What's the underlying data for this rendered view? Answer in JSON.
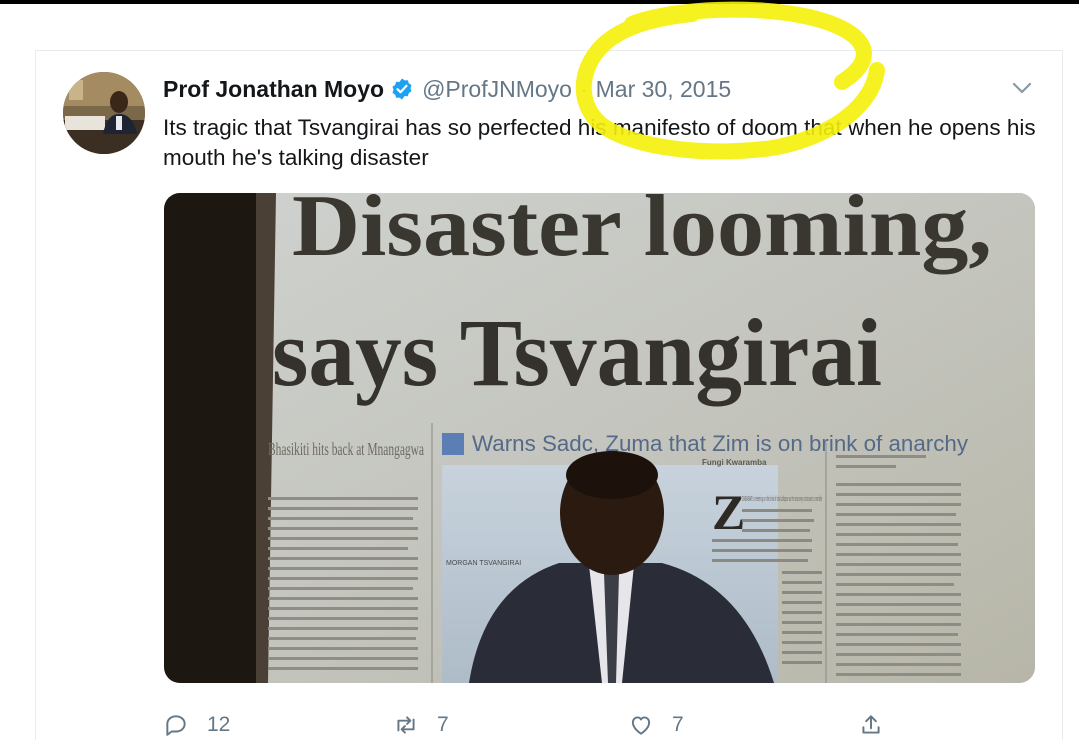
{
  "tweet": {
    "author_name": "Prof Jonathan Moyo",
    "handle": "@ProfJNMoyo",
    "separator": "·",
    "date": "Mar 30, 2015",
    "text": "Its tragic that Tsvangirai has so perfected his manifesto of doom that when he opens his mouth he's talking disaster",
    "verified": true,
    "icons": [
      "verified-badge-icon",
      "chevron-down-icon",
      "reply-icon",
      "retweet-icon",
      "like-icon",
      "share-icon"
    ]
  },
  "media": {
    "headline_line1": "Disaster looming,",
    "headline_line2": "says Tsvangirai",
    "subhead": "Warns Sadc, Zuma that Zim is on brink of anarchy",
    "side_headline": "Bhasikiti hits back at Mnangagwa",
    "photo_caption": "MORGAN TSVANGIRAI",
    "byline": "Fungi Kwaramba",
    "column_text": "ZIMBABWE is teetering on the brink of total collapse as the economy continues to crumble"
  },
  "actions": {
    "reply_count": "12",
    "retweet_count": "7",
    "like_count": "7"
  },
  "colors": {
    "accent": "#1da1f2",
    "muted": "#657786",
    "highlight": "#f5f10a"
  }
}
